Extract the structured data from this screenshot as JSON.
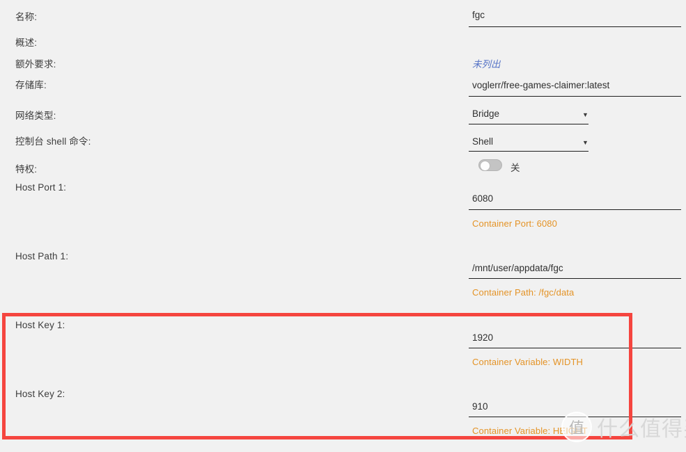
{
  "theme": {
    "background": "#f1f1f1",
    "label_color": "#3d3d3d",
    "value_color": "#2f2f2f",
    "hint_color": "#e49326",
    "link_color": "#5573c6",
    "rule_color": "#1e1e1e",
    "highlight_color": "#f5453f"
  },
  "form": {
    "rows": [
      {
        "label": "名称:",
        "value": "fgc"
      },
      {
        "label": "概述:"
      },
      {
        "label": "额外要求:",
        "link": "未列出"
      },
      {
        "label": "存储库:",
        "value": "voglerr/free-games-claimer:latest"
      },
      {
        "label": "网络类型:",
        "select": "Bridge"
      },
      {
        "label": "控制台 shell 命令:",
        "select": "Shell"
      },
      {
        "label": "特权:",
        "toggle_state": "关"
      },
      {
        "label": "Host Port 1:",
        "value": "6080",
        "hint": "Container Port: 6080"
      },
      {
        "label": "Host Path 1:",
        "value": "/mnt/user/appdata/fgc",
        "hint": "Container Path: /fgc/data"
      },
      {
        "label": "Host Key 1:",
        "value": "1920",
        "hint": "Container Variable: WIDTH"
      },
      {
        "label": "Host Key 2:",
        "value": "910",
        "hint": "Container Variable: HEIGHT"
      }
    ],
    "select_caret": "▼"
  },
  "labels": {
    "name": "名称:",
    "overview": "概述:",
    "extra_requirement": "额外要求:",
    "repository": "存储库:",
    "network_type": "网络类型:",
    "console_shell_command": "控制台 shell 命令:",
    "privileged": "特权:",
    "host_port_1": "Host Port 1:",
    "host_path_1": "Host Path 1:",
    "host_key_1": "Host Key 1:",
    "host_key_2": "Host Key 2:"
  },
  "values": {
    "name": "fgc",
    "extra_requirement_link": "未列出",
    "repository": "voglerr/free-games-claimer:latest",
    "network_type": "Bridge",
    "console_shell_command": "Shell",
    "privileged_state": "关",
    "host_port_1": "6080",
    "host_port_1_hint": "Container Port: 6080",
    "host_path_1": "/mnt/user/appdata/fgc",
    "host_path_1_hint": "Container Path: /fgc/data",
    "host_key_1": "1920",
    "host_key_1_hint": "Container Variable: WIDTH",
    "host_key_2": "910",
    "host_key_2_hint": "Container Variable: HEIGHT"
  },
  "select_caret": "▼",
  "watermark": {
    "logo_glyph": "值",
    "text": "什么值得买"
  }
}
